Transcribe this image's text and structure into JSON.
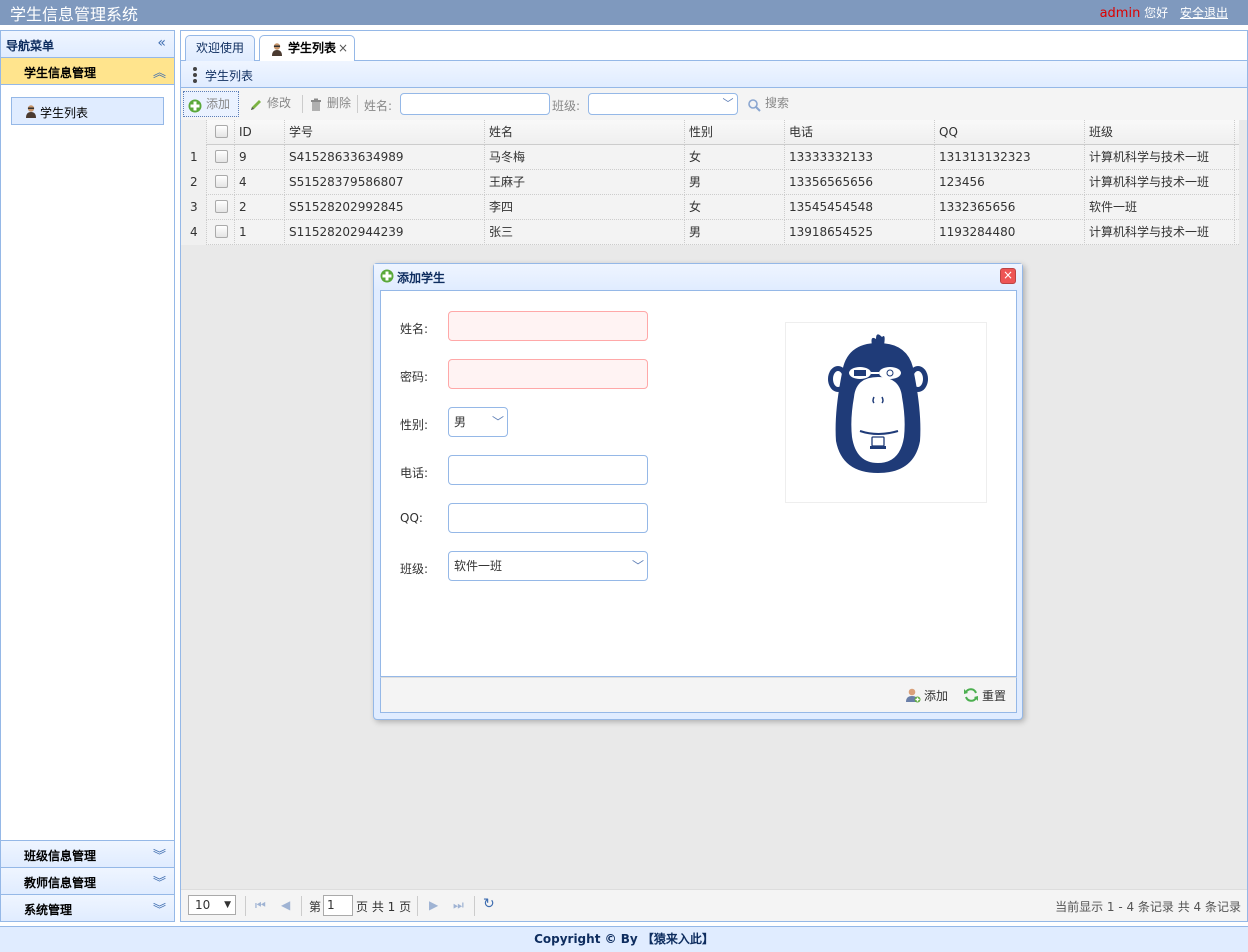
{
  "header": {
    "title": "学生信息管理系统",
    "username": "admin",
    "greeting": "您好",
    "logout": "安全退出"
  },
  "sidebar": {
    "title": "导航菜单",
    "sections": [
      {
        "label": "学生信息管理",
        "expanded": true,
        "items": [
          {
            "label": "学生列表",
            "icon": "user-student-icon"
          }
        ]
      },
      {
        "label": "班级信息管理",
        "expanded": false
      },
      {
        "label": "教师信息管理",
        "expanded": false
      },
      {
        "label": "系统管理",
        "expanded": false
      }
    ]
  },
  "tabs": [
    {
      "label": "欢迎使用",
      "active": false
    },
    {
      "label": "学生列表",
      "active": true,
      "closable": true,
      "close": "×"
    }
  ],
  "panel": {
    "title": "学生列表"
  },
  "toolbar": {
    "add": "添加",
    "edit": "修改",
    "delete": "删除",
    "name_label": "姓名:",
    "name_value": "",
    "class_label": "班级:",
    "class_value": "",
    "search": "搜索"
  },
  "grid": {
    "columns": [
      "ID",
      "学号",
      "姓名",
      "性别",
      "电话",
      "QQ",
      "班级"
    ],
    "rows": [
      {
        "num": "1",
        "id": "9",
        "sn": "S41528633634989",
        "name": "马冬梅",
        "sex": "女",
        "phone": "13333332133",
        "qq": "131313132323",
        "cls": "计算机科学与技术一班"
      },
      {
        "num": "2",
        "id": "4",
        "sn": "S51528379586807",
        "name": "王麻子",
        "sex": "男",
        "phone": "13356565656",
        "qq": "123456",
        "cls": "计算机科学与技术一班"
      },
      {
        "num": "3",
        "id": "2",
        "sn": "S51528202992845",
        "name": "李四",
        "sex": "女",
        "phone": "13545454548",
        "qq": "1332365656",
        "cls": "软件一班"
      },
      {
        "num": "4",
        "id": "1",
        "sn": "S11528202944239",
        "name": "张三",
        "sex": "男",
        "phone": "13918654525",
        "qq": "1193284480",
        "cls": "计算机科学与技术一班"
      }
    ]
  },
  "pager": {
    "page_size": "10",
    "page_prefix": "第",
    "page": "1",
    "page_suffix": "页 共 1 页",
    "info": "当前显示 1 - 4 条记录 共 4 条记录"
  },
  "dialog": {
    "title": "添加学生",
    "close": "×",
    "fields": {
      "name_label": "姓名:",
      "name_value": "",
      "password_label": "密码:",
      "password_value": "",
      "sex_label": "性别:",
      "sex_value": "男",
      "phone_label": "电话:",
      "phone_value": "",
      "qq_label": "QQ:",
      "qq_value": "",
      "class_label": "班级:",
      "class_value": "软件一班"
    },
    "add_button": "添加",
    "reset_button": "重置"
  },
  "footer": {
    "copyright": "Copyright © By 【猿来入此】"
  },
  "colors": {
    "header_bg": "#7f99be",
    "panel_border": "#95b8e7",
    "active_section": "#ffe48d",
    "admin_name": "#dd0000",
    "invalid_bg": "#fff3f3",
    "monkey": "#1f3b78"
  }
}
